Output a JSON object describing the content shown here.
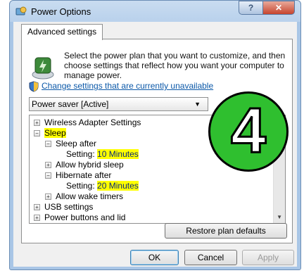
{
  "window": {
    "title": "Power Options",
    "help_glyph": "?",
    "close_glyph": "✕"
  },
  "tab": {
    "label": "Advanced settings"
  },
  "description": "Select the power plan that you want to customize, and then choose settings that reflect how you want your computer to manage power.",
  "change_link": "Change settings that are currently unavailable",
  "plan_select": {
    "value": "Power saver [Active]"
  },
  "tree": {
    "rows": [
      {
        "expander": "+",
        "label": "Wireless Adapter Settings"
      },
      {
        "expander": "−",
        "label": "Sleep"
      },
      {
        "expander": "−",
        "label": "Sleep after"
      },
      {
        "label": "Setting:",
        "value": "10 Minutes"
      },
      {
        "expander": "+",
        "label": "Allow hybrid sleep"
      },
      {
        "expander": "−",
        "label": "Hibernate after"
      },
      {
        "label": "Setting:",
        "value": "20 Minutes"
      },
      {
        "expander": "+",
        "label": "Allow wake timers"
      },
      {
        "expander": "+",
        "label": "USB settings"
      },
      {
        "expander": "+",
        "label": "Power buttons and lid"
      }
    ]
  },
  "badge": {
    "number": "4",
    "color": "#2fbf2f"
  },
  "buttons": {
    "restore": "Restore plan defaults",
    "ok": "OK",
    "cancel": "Cancel",
    "apply": "Apply"
  },
  "colors": {
    "highlight": "#ffff00",
    "link": "#0b58a8"
  }
}
